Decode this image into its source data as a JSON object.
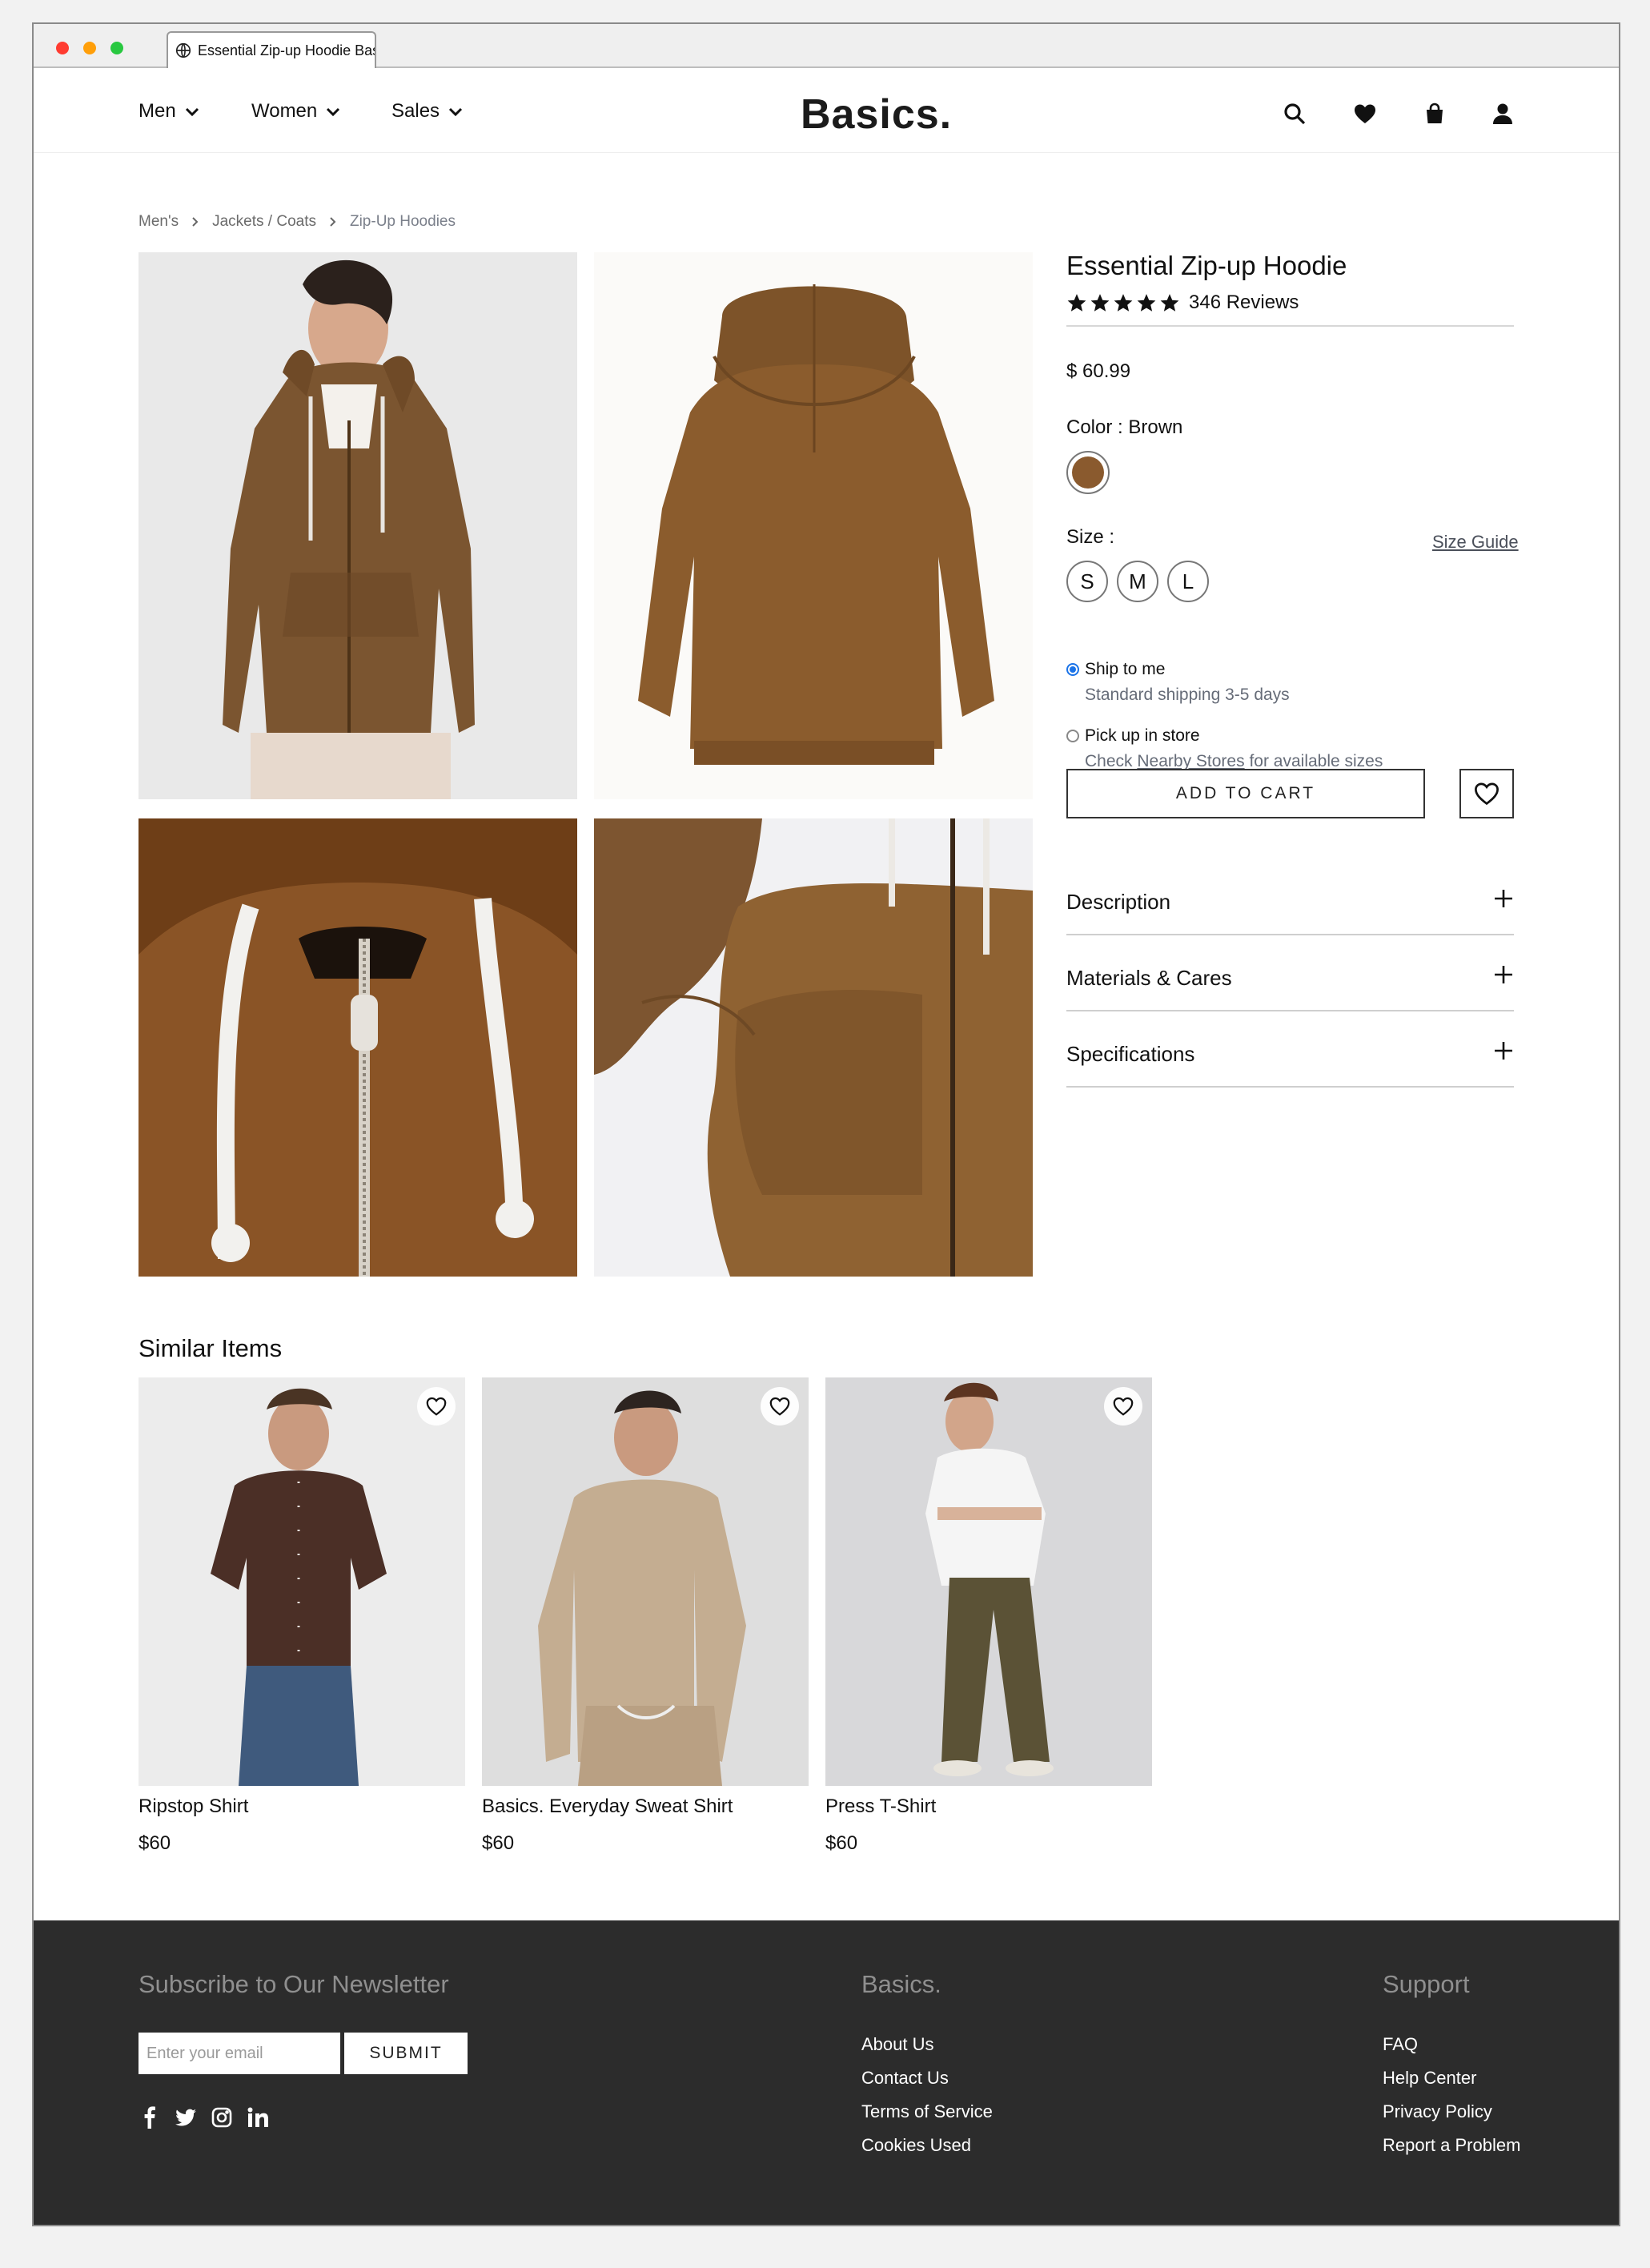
{
  "browser": {
    "tab_title": "Essential Zip-up Hoodie Bas"
  },
  "header": {
    "nav": [
      {
        "label": "Men"
      },
      {
        "label": "Women"
      },
      {
        "label": "Sales"
      }
    ],
    "logo": "Basics.",
    "icons": [
      "search-icon",
      "heart-icon",
      "bag-icon",
      "user-icon"
    ]
  },
  "breadcrumb": {
    "items": [
      "Men's",
      "Jackets / Coats",
      "Zip-Up Hoodies"
    ]
  },
  "product": {
    "title": "Essential Zip-up Hoodie",
    "rating": 5,
    "reviews_label": "346 Reviews",
    "price": "$ 60.99",
    "color_label": "Color : Brown",
    "color_hex": "#8a5a2e",
    "size_label": "Size :",
    "size_guide": "Size Guide",
    "sizes": [
      "S",
      "M",
      "L"
    ],
    "shipping": {
      "option1_label": "Ship to me",
      "option1_sub": "Standard shipping 3-5 days",
      "option2_label": "Pick up in store",
      "option2_sub_before": "Check",
      "option2_link": "Nearby Stores",
      "option2_sub_after": "for available sizes"
    },
    "add_to_cart": "ADD TO CART",
    "accordions": [
      "Description",
      "Materials & Cares",
      "Specifications"
    ]
  },
  "similar": {
    "title": "Similar Items",
    "items": [
      {
        "name": "Ripstop Shirt",
        "price": "$60"
      },
      {
        "name": "Basics. Everyday Sweat Shirt",
        "price": "$60"
      },
      {
        "name": "Press T-Shirt",
        "price": "$60"
      }
    ]
  },
  "footer": {
    "newsletter_title": "Subscribe to Our Newsletter",
    "email_placeholder": "Enter your email",
    "submit_label": "SUBMIT",
    "social_icons": [
      "facebook-icon",
      "twitter-icon",
      "instagram-icon",
      "linkedin-icon"
    ],
    "brand_title": "Basics.",
    "brand_links": [
      "About Us",
      "Contact Us",
      "Terms of Service",
      "Cookies Used"
    ],
    "support_title": "Support",
    "support_links": [
      "FAQ",
      "Help Center",
      "Privacy Policy",
      "Report a Problem"
    ]
  },
  "colors": {
    "footer_bg": "#2c2c2c",
    "brown": "#8a5a2e",
    "radio_accent": "#1a73e8"
  }
}
